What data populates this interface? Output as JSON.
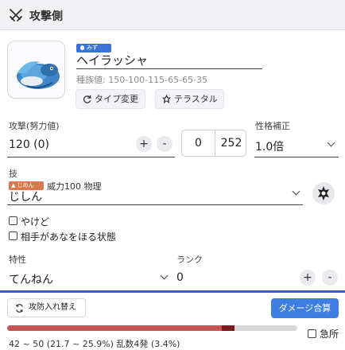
{
  "header": {
    "title": "攻撃側",
    "icon": "crossed-swords-icon"
  },
  "pokemon": {
    "type_badge": "みず",
    "type_color": "#3b73d6",
    "name": "ヘイラッシャ",
    "base_stats": "種族値: 150-100-115-65-65-35",
    "type_change_label": "タイプ変更",
    "terastal_label": "テラスタル"
  },
  "stat": {
    "label": "攻撃(努力値)",
    "value": "120 (0)",
    "plus": "+",
    "minus": "-",
    "ev_left": "0",
    "ev_right": "252"
  },
  "nature": {
    "label": "性格補正",
    "value": "1.0倍"
  },
  "move": {
    "label": "技",
    "type_badge": "じめん",
    "type_color": "#d9784c",
    "info": "威力100 物理",
    "name": "じしん"
  },
  "options": {
    "burn": "やけど",
    "dig": "相手があなをほる状態"
  },
  "ability": {
    "label": "特性",
    "value": "てんねん"
  },
  "rank": {
    "label": "ランク",
    "value": "0",
    "plus": "+",
    "minus": "-"
  },
  "actions": {
    "swap_label": "攻防入れ替え",
    "calc_label": "ダメージ合算"
  },
  "damage": {
    "min_percent": 21.7,
    "max_percent": 25.9,
    "result_text": "42 ~ 50 (21.7 ~ 25.9%) 乱数4発 (3.4%)",
    "bar_color": "#c75454",
    "bar_max_color": "#7a1c1c"
  },
  "critical": {
    "label": "急所"
  }
}
